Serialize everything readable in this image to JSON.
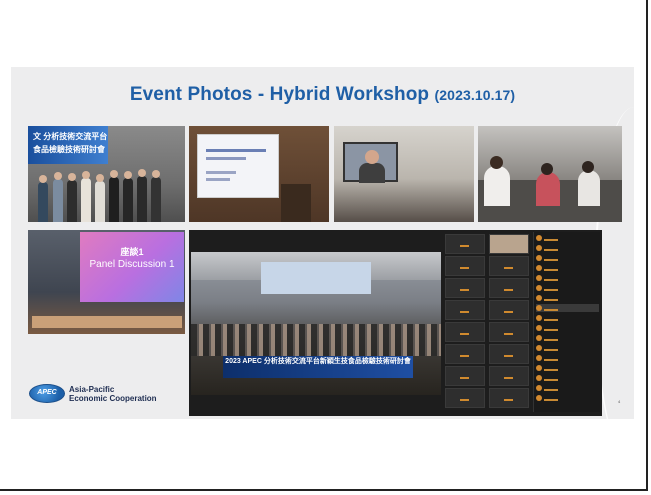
{
  "slide": {
    "title": "Event Photos - Hybrid Workshop",
    "date": "(2023.10.17)",
    "page_number": "4"
  },
  "photos": {
    "stage_banner": "文 分析技術交流平台\n食品檢驗技術研討會",
    "panel_screen_line1": "座談1",
    "panel_screen_line2": "Panel Discussion 1",
    "hall_backdrop": "2023 APEC 分析技術交流平台新穎生技食品檢驗技術研討會"
  },
  "logo": {
    "badge": "APEC",
    "line1": "Asia-Pacific",
    "line2": "Economic Cooperation"
  }
}
